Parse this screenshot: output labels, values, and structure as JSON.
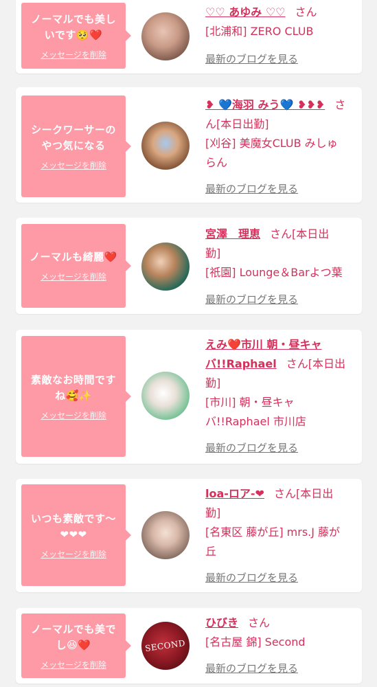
{
  "entries": [
    {
      "message_line1": "ノーマルでも美し",
      "message_line2": "いです🥺❤️",
      "delete_label": "メッセージを削除",
      "name": "♡♡ あゆみ ♡♡",
      "san": "さん",
      "status": "",
      "shop": "[北浦和] ZERO CLUB",
      "blog_label": "最新のブログを見る"
    },
    {
      "message_line1": "シークワーサーの",
      "message_line2": "やつ気になる",
      "delete_label": "メッセージを削除",
      "name": "❥ 💙海羽 みう💙 ❥❥❥",
      "san": "さ",
      "status": "ん[本日出勤]",
      "shop": "[刈谷] 美魔女CLUB みしゅ",
      "shop2": "らん",
      "blog_label": "最新のブログを見る"
    },
    {
      "message_line1": "ノーマルも綺麗❤️",
      "message_line2": "",
      "delete_label": "メッセージを削除",
      "name": "宮澤　理恵",
      "san": "さん[本日出",
      "status": "勤]",
      "shop": "[祇園] Lounge＆Barよつ葉",
      "blog_label": "最新のブログを見る"
    },
    {
      "message_line1": "素敵なお時間です",
      "message_line2": "ね🥰✨",
      "delete_label": "メッセージを削除",
      "name": "えみ❤️市川 朝・昼キャ",
      "name2": "バ!!Raphael",
      "san": "さん[本日出",
      "status": "勤]",
      "shop": "[市川] 朝・昼キャ",
      "shop2": "バ!!Raphael 市川店",
      "blog_label": "最新のブログを見る"
    },
    {
      "message_line1": "いつも素敵です〜",
      "message_line2": "❤❤❤",
      "delete_label": "メッセージを削除",
      "name": "loa-ロア-❤",
      "san": "さん[本日出",
      "status": "勤]",
      "shop": "[名東区 藤が丘] mrs.J 藤が",
      "shop2": "丘",
      "blog_label": "最新のブログを見る"
    },
    {
      "message_line1": "ノーマルでも美で",
      "message_line2": "し😆❤️",
      "delete_label": "メッセージを削除",
      "name": "ひびき",
      "san": "さん",
      "status": "",
      "shop": "[名古屋 錦] Second",
      "avatar_text": "SECOND",
      "blog_label": "最新のブログを見る"
    }
  ],
  "colors": {
    "bubble": "#fd9aa6",
    "accent": "#d4305b",
    "muted": "#777777",
    "background": "#f2f2f2"
  }
}
